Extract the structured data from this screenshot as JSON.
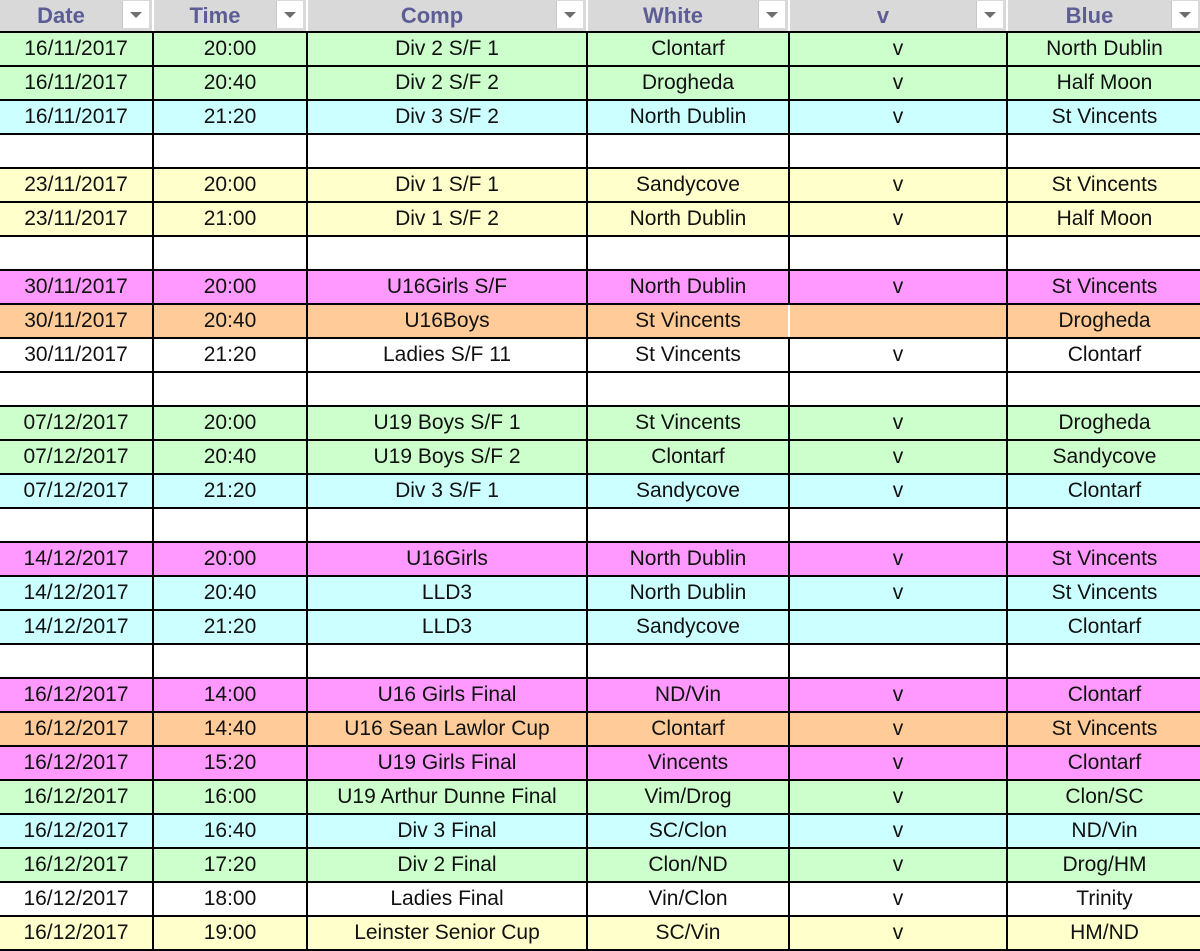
{
  "headers": [
    {
      "key": "date",
      "label": "Date"
    },
    {
      "key": "time",
      "label": "Time"
    },
    {
      "key": "comp",
      "label": "Comp"
    },
    {
      "key": "white",
      "label": "White"
    },
    {
      "key": "v",
      "label": "v"
    },
    {
      "key": "blue",
      "label": "Blue"
    }
  ],
  "row_colors": {
    "green": "#ccffcc",
    "cyan": "#ccffff",
    "yellow": "#ffffcc",
    "pink": "#ff99ff",
    "orange": "#ffcc99",
    "white": "#ffffff"
  },
  "rows": [
    {
      "color": "green",
      "date": "16/11/2017",
      "time": "20:00",
      "comp": "Div 2 S/F 1",
      "white": "Clontarf",
      "v": "v",
      "blue": "North Dublin"
    },
    {
      "color": "green",
      "date": "16/11/2017",
      "time": "20:40",
      "comp": "Div 2 S/F 2",
      "white": "Drogheda",
      "v": "v",
      "blue": "Half Moon"
    },
    {
      "color": "cyan",
      "date": "16/11/2017",
      "time": "21:20",
      "comp": "Div 3 S/F 2",
      "white": "North Dublin",
      "v": "v",
      "blue": "St Vincents"
    },
    {
      "color": "white",
      "date": "",
      "time": "",
      "comp": "",
      "white": "",
      "v": "",
      "blue": ""
    },
    {
      "color": "yellow",
      "date": "23/11/2017",
      "time": "20:00",
      "comp": "Div 1 S/F 1",
      "white": "Sandycove",
      "v": "v",
      "blue": "St Vincents"
    },
    {
      "color": "yellow",
      "date": "23/11/2017",
      "time": "21:00",
      "comp": "Div 1 S/F 2",
      "white": "North Dublin",
      "v": "v",
      "blue": "Half Moon"
    },
    {
      "color": "white",
      "date": "",
      "time": "",
      "comp": "",
      "white": "",
      "v": "",
      "blue": ""
    },
    {
      "color": "pink",
      "date": "30/11/2017",
      "time": "20:00",
      "comp": "U16Girls S/F",
      "white": "North Dublin",
      "v": "v",
      "blue": "St Vincents"
    },
    {
      "color": "orange",
      "date": "30/11/2017",
      "time": "20:40",
      "comp": "U16Boys",
      "white": "St Vincents",
      "v": "",
      "blue": "Drogheda",
      "merged": true
    },
    {
      "color": "white",
      "date": "30/11/2017",
      "time": "21:20",
      "comp": "Ladies S/F 11",
      "white": "St Vincents",
      "v": "v",
      "blue": "Clontarf"
    },
    {
      "color": "white",
      "date": "",
      "time": "",
      "comp": "",
      "white": "",
      "v": "",
      "blue": ""
    },
    {
      "color": "green",
      "date": "07/12/2017",
      "time": "20:00",
      "comp": "U19 Boys S/F 1",
      "white": "St Vincents",
      "v": "v",
      "blue": "Drogheda"
    },
    {
      "color": "green",
      "date": "07/12/2017",
      "time": "20:40",
      "comp": "U19 Boys S/F 2",
      "white": "Clontarf",
      "v": "v",
      "blue": "Sandycove"
    },
    {
      "color": "cyan",
      "date": "07/12/2017",
      "time": "21:20",
      "comp": "Div 3 S/F 1",
      "white": "Sandycove",
      "v": "v",
      "blue": "Clontarf"
    },
    {
      "color": "white",
      "date": "",
      "time": "",
      "comp": "",
      "white": "",
      "v": "",
      "blue": ""
    },
    {
      "color": "pink",
      "date": "14/12/2017",
      "time": "20:00",
      "comp": "U16Girls",
      "white": "North Dublin",
      "v": "v",
      "blue": "St Vincents"
    },
    {
      "color": "cyan",
      "date": "14/12/2017",
      "time": "20:40",
      "comp": "LLD3",
      "white": "North Dublin",
      "v": "v",
      "blue": "St Vincents"
    },
    {
      "color": "cyan",
      "date": "14/12/2017",
      "time": "21:20",
      "comp": "LLD3",
      "white": "Sandycove",
      "v": "",
      "blue": "Clontarf"
    },
    {
      "color": "white",
      "date": "",
      "time": "",
      "comp": "",
      "white": "",
      "v": "",
      "blue": ""
    },
    {
      "color": "pink",
      "date": "16/12/2017",
      "time": "14:00",
      "comp": "U16 Girls Final",
      "white": "ND/Vin",
      "v": "v",
      "blue": "Clontarf"
    },
    {
      "color": "orange",
      "date": "16/12/2017",
      "time": "14:40",
      "comp": "U16 Sean Lawlor Cup",
      "white": "Clontarf",
      "v": "v",
      "blue": "St Vincents"
    },
    {
      "color": "pink",
      "date": "16/12/2017",
      "time": "15:20",
      "comp": "U19 Girls Final",
      "white": "Vincents",
      "v": "v",
      "blue": "Clontarf"
    },
    {
      "color": "green",
      "date": "16/12/2017",
      "time": "16:00",
      "comp": "U19 Arthur Dunne Final",
      "white": "Vim/Drog",
      "v": "v",
      "blue": "Clon/SC"
    },
    {
      "color": "cyan",
      "date": "16/12/2017",
      "time": "16:40",
      "comp": "Div 3 Final",
      "white": "SC/Clon",
      "v": "v",
      "blue": "ND/Vin"
    },
    {
      "color": "green",
      "date": "16/12/2017",
      "time": "17:20",
      "comp": "Div 2 Final",
      "white": "Clon/ND",
      "v": "v",
      "blue": "Drog/HM"
    },
    {
      "color": "white",
      "date": "16/12/2017",
      "time": "18:00",
      "comp": "Ladies Final",
      "white": "Vin/Clon",
      "v": "v",
      "blue": "Trinity"
    },
    {
      "color": "yellow",
      "date": "16/12/2017",
      "time": "19:00",
      "comp": "Leinster Senior Cup",
      "white": "SC/Vin",
      "v": "v",
      "blue": "HM/ND"
    }
  ]
}
